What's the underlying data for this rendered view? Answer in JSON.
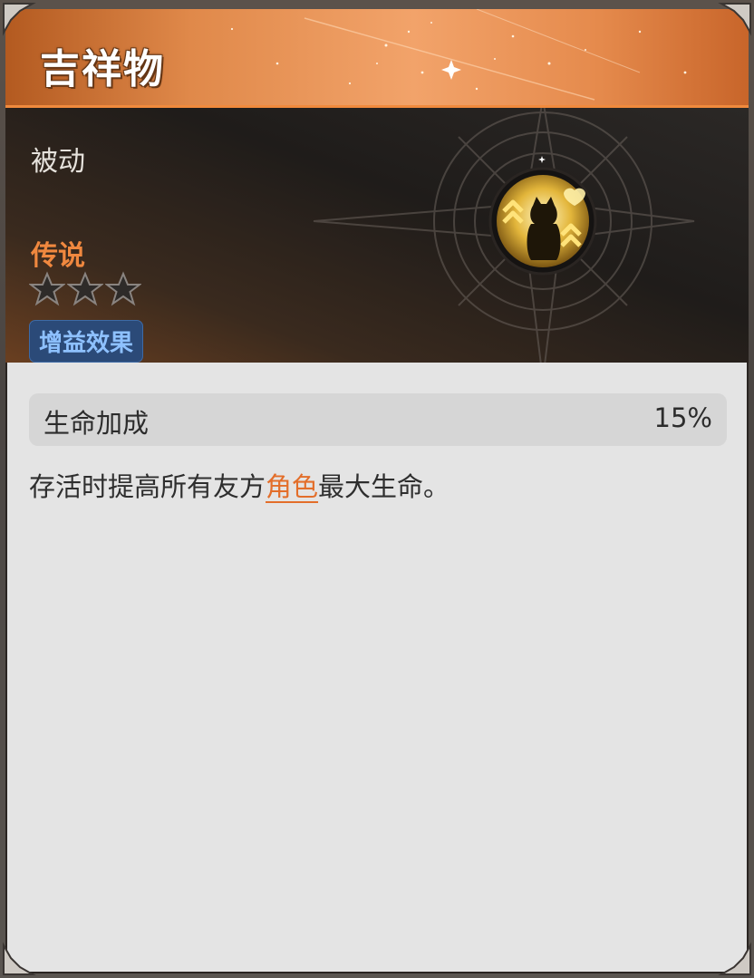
{
  "card": {
    "title": "吉祥物",
    "type": "被动",
    "rarity": "传说",
    "stars_total": 3,
    "stars_filled": 0,
    "tag": "增益效果",
    "emblem_icon": "mascot-cat-buff-icon"
  },
  "stat": {
    "label": "生命加成",
    "value": "15%"
  },
  "description": {
    "before": "存活时提高所有友方",
    "keyword": "角色",
    "after": "最大生命。"
  },
  "colors": {
    "header_accent": "#f08a3d",
    "rarity": "#f0883f",
    "tag_bg": "#2b4a78",
    "tag_text": "#8ec1ff",
    "keyword": "#e36e2a",
    "body_bg": "#e4e4e4"
  }
}
